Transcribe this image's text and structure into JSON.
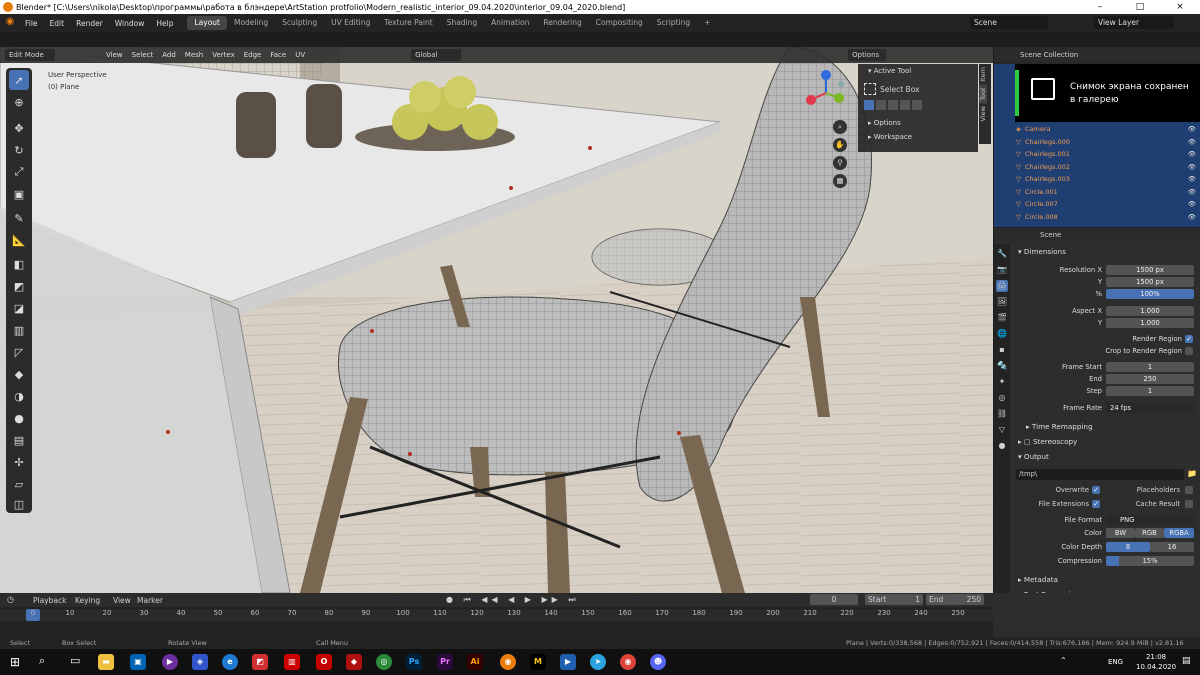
{
  "window": {
    "title": "Blender* [C:\\Users\\nikola\\Desktop\\программы\\работа в блэндере\\ArtStation protfolio\\Modern_realistic_interior_09.04.2020\\interior_09.04_2020.blend]",
    "controls": [
      "–",
      "□",
      "×"
    ]
  },
  "menu": [
    "File",
    "Edit",
    "Render",
    "Window",
    "Help"
  ],
  "workspaces": [
    {
      "label": "Layout",
      "active": true
    },
    {
      "label": "Modeling"
    },
    {
      "label": "Sculpting"
    },
    {
      "label": "UV Editing"
    },
    {
      "label": "Texture Paint"
    },
    {
      "label": "Shading"
    },
    {
      "label": "Animation"
    },
    {
      "label": "Rendering"
    },
    {
      "label": "Compositing"
    },
    {
      "label": "Scripting"
    }
  ],
  "scene_field": "Scene",
  "view_layer_field": "View Layer",
  "viewport_header": {
    "mode": "Edit Mode",
    "menus": [
      "View",
      "Select",
      "Add",
      "Mesh",
      "Vertex",
      "Edge",
      "Face",
      "UV"
    ],
    "transform_orientation": "Global",
    "options": "Options"
  },
  "viewport_overlay": {
    "perspective": "User Perspective",
    "object": "(0) Plane"
  },
  "npanel": {
    "active_tool_header": "Active Tool",
    "active_tool": "Select Box",
    "options": "Options",
    "workspace": "Workspace",
    "tabs": [
      "Item",
      "Tool",
      "View"
    ]
  },
  "outliner": {
    "header": "Scene Collection",
    "items": [
      {
        "name": "Camera"
      },
      {
        "name": "Chairlegs.000"
      },
      {
        "name": "Chairlegs.001"
      },
      {
        "name": "Chairlegs.002"
      },
      {
        "name": "Chairlegs.003"
      },
      {
        "name": "Circle.001"
      },
      {
        "name": "Circle.007"
      },
      {
        "name": "Circle.008"
      }
    ]
  },
  "toast": {
    "text": "Снимок экрана сохранен в галерею"
  },
  "properties": {
    "context": "Scene",
    "dimensions_header": "Dimensions",
    "resolution_x_label": "Resolution X",
    "resolution_x": "1500 px",
    "y_label": "Y",
    "resolution_y": "1500 px",
    "percent_label": "%",
    "resolution_percent": "100%",
    "aspect_x_label": "Aspect X",
    "aspect_x": "1.000",
    "aspect_y_label": "Y",
    "aspect_y": "1.000",
    "render_region": "Render Region",
    "crop_region": "Crop to Render Region",
    "frame_start_label": "Frame Start",
    "frame_start": "1",
    "end_label": "End",
    "frame_end": "250",
    "step_label": "Step",
    "frame_step": "1",
    "frame_rate_label": "Frame Rate",
    "frame_rate": "24 fps",
    "time_remapping": "Time Remapping",
    "stereoscopy": "Stereoscopy",
    "output_header": "Output",
    "output_path": "/tmp\\",
    "overwrite": "Overwrite",
    "placeholders": "Placeholders",
    "file_extensions": "File Extensions",
    "cache_result": "Cache Result",
    "file_format_label": "File Format",
    "file_format": "PNG",
    "color_label": "Color",
    "color_options": [
      "BW",
      "RGB",
      "RGBA"
    ],
    "color_depth_label": "Color Depth",
    "color_depth_options": [
      "8",
      "16"
    ],
    "compression_label": "Compression",
    "compression": "15%",
    "metadata": "Metadata",
    "post_processing": "Post Processing"
  },
  "timeline": {
    "menus": [
      "Playback",
      "Keying",
      "View",
      "Marker"
    ],
    "current_frame": "0",
    "start_label": "Start",
    "start": "1",
    "end_label": "End",
    "end": "250",
    "ticks": [
      "0",
      "10",
      "20",
      "30",
      "40",
      "50",
      "60",
      "70",
      "80",
      "90",
      "100",
      "110",
      "120",
      "130",
      "140",
      "150",
      "160",
      "170",
      "180",
      "190",
      "200",
      "210",
      "220",
      "230",
      "240",
      "250"
    ]
  },
  "statusbar": {
    "select": "Select",
    "box_select": "Box Select",
    "rotate_view": "Rotate View",
    "call_menu": "Call Menu",
    "stats": "Plane | Verts:0/338,568 | Edges:0/752,921 | Faces:0/414,558 | Tris:676,186 | Mem: 924.9 MiB | v2.81.16"
  },
  "taskbar": {
    "language": "ENG",
    "time": "21:08",
    "date": "10.04.2020"
  },
  "colors": {
    "accent": "#4772b3",
    "orange_object": "#f39a53",
    "selection_bg": "#1f3f73"
  }
}
